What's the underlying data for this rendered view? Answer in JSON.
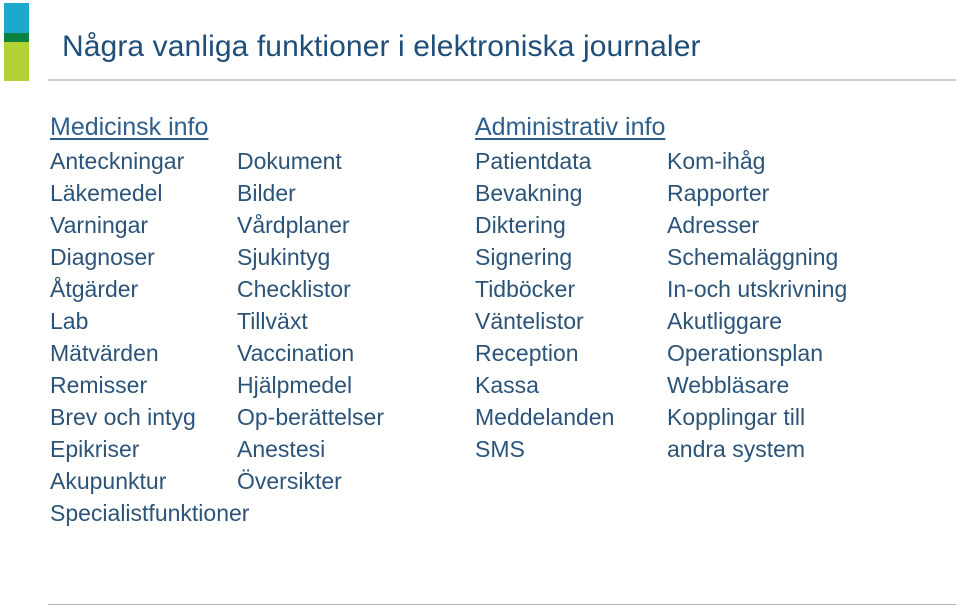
{
  "slide": {
    "title": "Några vanliga funktioner i elektroniska journaler",
    "accent_colors": {
      "top": "#1BA9CE",
      "middle": "#0E8140",
      "bottom": "#B2D235"
    },
    "title_color": "#1F4E79",
    "heading_color": "#2E5E8C",
    "body_color": "#2C5378",
    "rule_color": "#C9CDD1"
  },
  "sections": [
    {
      "id": "medicinsk-info",
      "heading": "Medicinsk info",
      "rows": [
        {
          "col1": "Anteckningar",
          "col2": "Dokument"
        },
        {
          "col1": "Läkemedel",
          "col2": "Bilder"
        },
        {
          "col1": "Varningar",
          "col2": "Vårdplaner"
        },
        {
          "col1": "Diagnoser",
          "col2": "Sjukintyg"
        },
        {
          "col1": "Åtgärder",
          "col2": "Checklistor"
        },
        {
          "col1": "Lab",
          "col2": "Tillväxt"
        },
        {
          "col1": "Mätvärden",
          "col2": "Vaccination"
        },
        {
          "col1": "Remisser",
          "col2": "Hjälpmedel"
        },
        {
          "col1": "Brev och intyg",
          "col2": "Op-berättelser"
        },
        {
          "col1": "Epikriser",
          "col2": "Anestesi"
        },
        {
          "col1": "Akupunktur",
          "col2": "Översikter"
        },
        {
          "col1": "Specialistfunktioner",
          "col2": ""
        }
      ]
    },
    {
      "id": "administrativ-info",
      "heading": "Administrativ info",
      "rows": [
        {
          "col1": "Patientdata",
          "col2": "Kom-ihåg"
        },
        {
          "col1": "Bevakning",
          "col2": "Rapporter"
        },
        {
          "col1": "Diktering",
          "col2": "Adresser"
        },
        {
          "col1": "Signering",
          "col2": "Schemaläggning"
        },
        {
          "col1": "Tidböcker",
          "col2": "In-och utskrivning"
        },
        {
          "col1": "Väntelistor",
          "col2": "Akutliggare"
        },
        {
          "col1": "Reception",
          "col2": "Operationsplan"
        },
        {
          "col1": "Kassa",
          "col2": "Webbläsare"
        },
        {
          "col1": "Meddelanden",
          "col2": "Kopplingar till"
        },
        {
          "col1": "SMS",
          "col2": "andra system"
        }
      ]
    }
  ]
}
